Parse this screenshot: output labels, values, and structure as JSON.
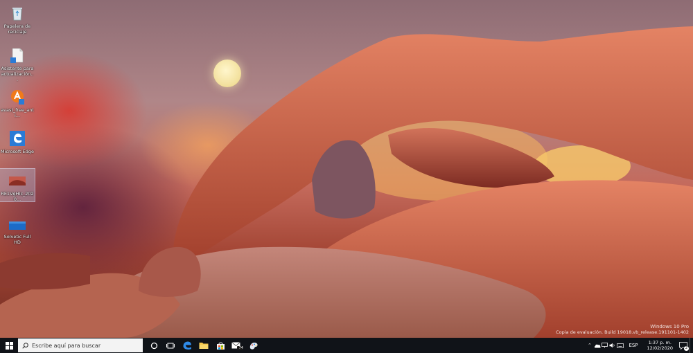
{
  "desktop": {
    "icons": [
      {
        "label": "Papelera de reciclaje",
        "icon": "recycle-bin-icon"
      },
      {
        "label": "Asistente para actualización...",
        "icon": "update-assistant-icon"
      },
      {
        "label": "avast_free_anti...",
        "icon": "avast-icon"
      },
      {
        "label": "Microsoft Edge",
        "icon": "edge-icon"
      },
      {
        "label": "RE1VgHIc_2020...",
        "icon": "image-file-icon"
      },
      {
        "label": "Solvetic Full HD",
        "icon": "image-file-icon"
      }
    ]
  },
  "watermark": {
    "title": "Windows 10 Pro",
    "build": "Copia de evaluación. Build 19018.vb_release.191101-1402"
  },
  "taskbar": {
    "search_placeholder": "Escribe aquí para buscar",
    "pinned": [
      {
        "name": "task-view-icon"
      },
      {
        "name": "edge-icon"
      },
      {
        "name": "file-explorer-icon"
      },
      {
        "name": "store-icon"
      },
      {
        "name": "mail-icon",
        "badge": "74"
      },
      {
        "name": "paint-icon"
      }
    ],
    "tray": {
      "language": "ESP",
      "time": "1:37 p. m.",
      "date": "12/02/2020",
      "notifications": "2"
    }
  },
  "colors": {
    "taskbar": "#101318",
    "active_indicator": "#7fb1e8",
    "edge": "#2b7bd6",
    "avast": "#f07a1a"
  }
}
